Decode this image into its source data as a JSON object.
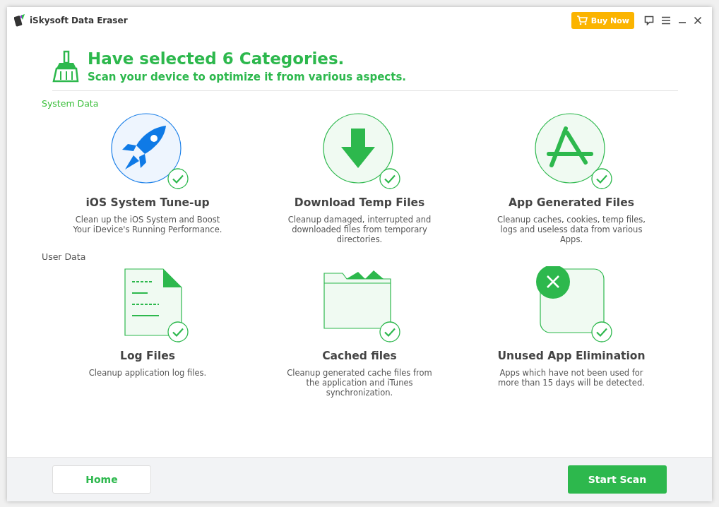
{
  "window": {
    "title": "iSkysoft Data Eraser",
    "buy_button": "Buy Now"
  },
  "hero": {
    "title": "Have selected 6 Categories.",
    "subtitle": "Scan your device to optimize it from various aspects."
  },
  "sections": [
    {
      "label": "System Data",
      "selected": true,
      "items": [
        {
          "kind": "rocket",
          "title": "iOS System Tune-up",
          "description": "Clean up the iOS System and Boost Your iDevice's Running Performance.",
          "selected": true,
          "checked": true
        },
        {
          "kind": "download",
          "title": "Download Temp Files",
          "description": "Cleanup damaged, interrupted and downloaded files from temporary directories.",
          "selected": false,
          "checked": true
        },
        {
          "kind": "appstore",
          "title": "App Generated Files",
          "description": "Cleanup caches, cookies, temp files, logs and useless data from various Apps.",
          "selected": false,
          "checked": true
        }
      ]
    },
    {
      "label": "User Data",
      "selected": false,
      "items": [
        {
          "kind": "log",
          "title": "Log Files",
          "description": "Cleanup application log files.",
          "selected": false,
          "checked": true
        },
        {
          "kind": "folder",
          "title": "Cached files",
          "description": "Cleanup generated cache files from the application and iTunes synchronization.",
          "selected": false,
          "checked": true
        },
        {
          "kind": "unused",
          "title": "Unused App Elimination",
          "description": "Apps which have not been used for more than 15 days will be detected.",
          "selected": false,
          "checked": true
        }
      ]
    }
  ],
  "footer": {
    "home_button": "Home",
    "scan_button": "Start Scan"
  }
}
